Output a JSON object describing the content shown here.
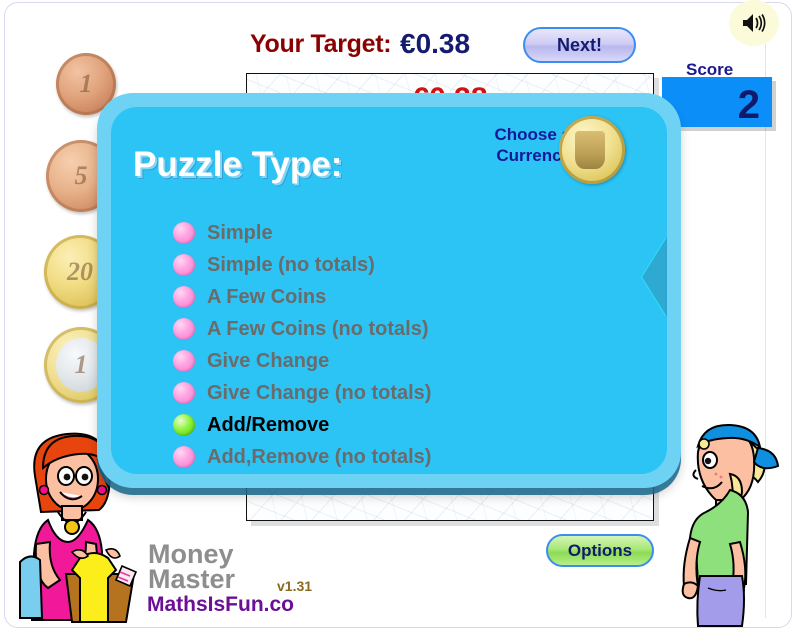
{
  "header": {
    "target_label": "Your Target:",
    "target_value": "€0.38",
    "next_label": "Next!",
    "speaker_icon": "speaker-on-icon"
  },
  "score": {
    "label": "Score",
    "value": "2"
  },
  "play_panel": {
    "total_text": "€0.38"
  },
  "dialog": {
    "title": "Puzzle Type:",
    "choose_currency_line1": "Choose a",
    "choose_currency_line2": "Currency",
    "currency_coin_icon": "euro-coin-icon",
    "next_arrow_icon": "arrow-right-icon",
    "options": [
      {
        "label": "Simple",
        "selected": false
      },
      {
        "label": "Simple (no totals)",
        "selected": false
      },
      {
        "label": "A Few Coins",
        "selected": false
      },
      {
        "label": "A Few Coins (no totals)",
        "selected": false
      },
      {
        "label": "Give Change",
        "selected": false
      },
      {
        "label": "Give Change (no totals)",
        "selected": false
      },
      {
        "label": "Add/Remove",
        "selected": true
      },
      {
        "label": "Add,Remove (no totals)",
        "selected": false
      }
    ]
  },
  "footer": {
    "options_label": "Options",
    "brand_line1": "Money",
    "brand_line2": "Master",
    "version": "v1.31",
    "site": "MathsIsFun.co"
  },
  "coins": [
    {
      "name": "coin-1-cent",
      "face": "1"
    },
    {
      "name": "coin-5-cent",
      "face": "5"
    },
    {
      "name": "coin-20-cent",
      "face": "20"
    },
    {
      "name": "coin-1-euro",
      "face": "1"
    }
  ],
  "colors": {
    "dialog_fill": "#2bc4f5",
    "dialog_border": "#6ed2f4",
    "score_box": "#0b8ef7",
    "target_label": "#8b0000",
    "target_value": "#151b6e",
    "selected_radio": "#49c808",
    "radio": "#ff9fe0"
  }
}
